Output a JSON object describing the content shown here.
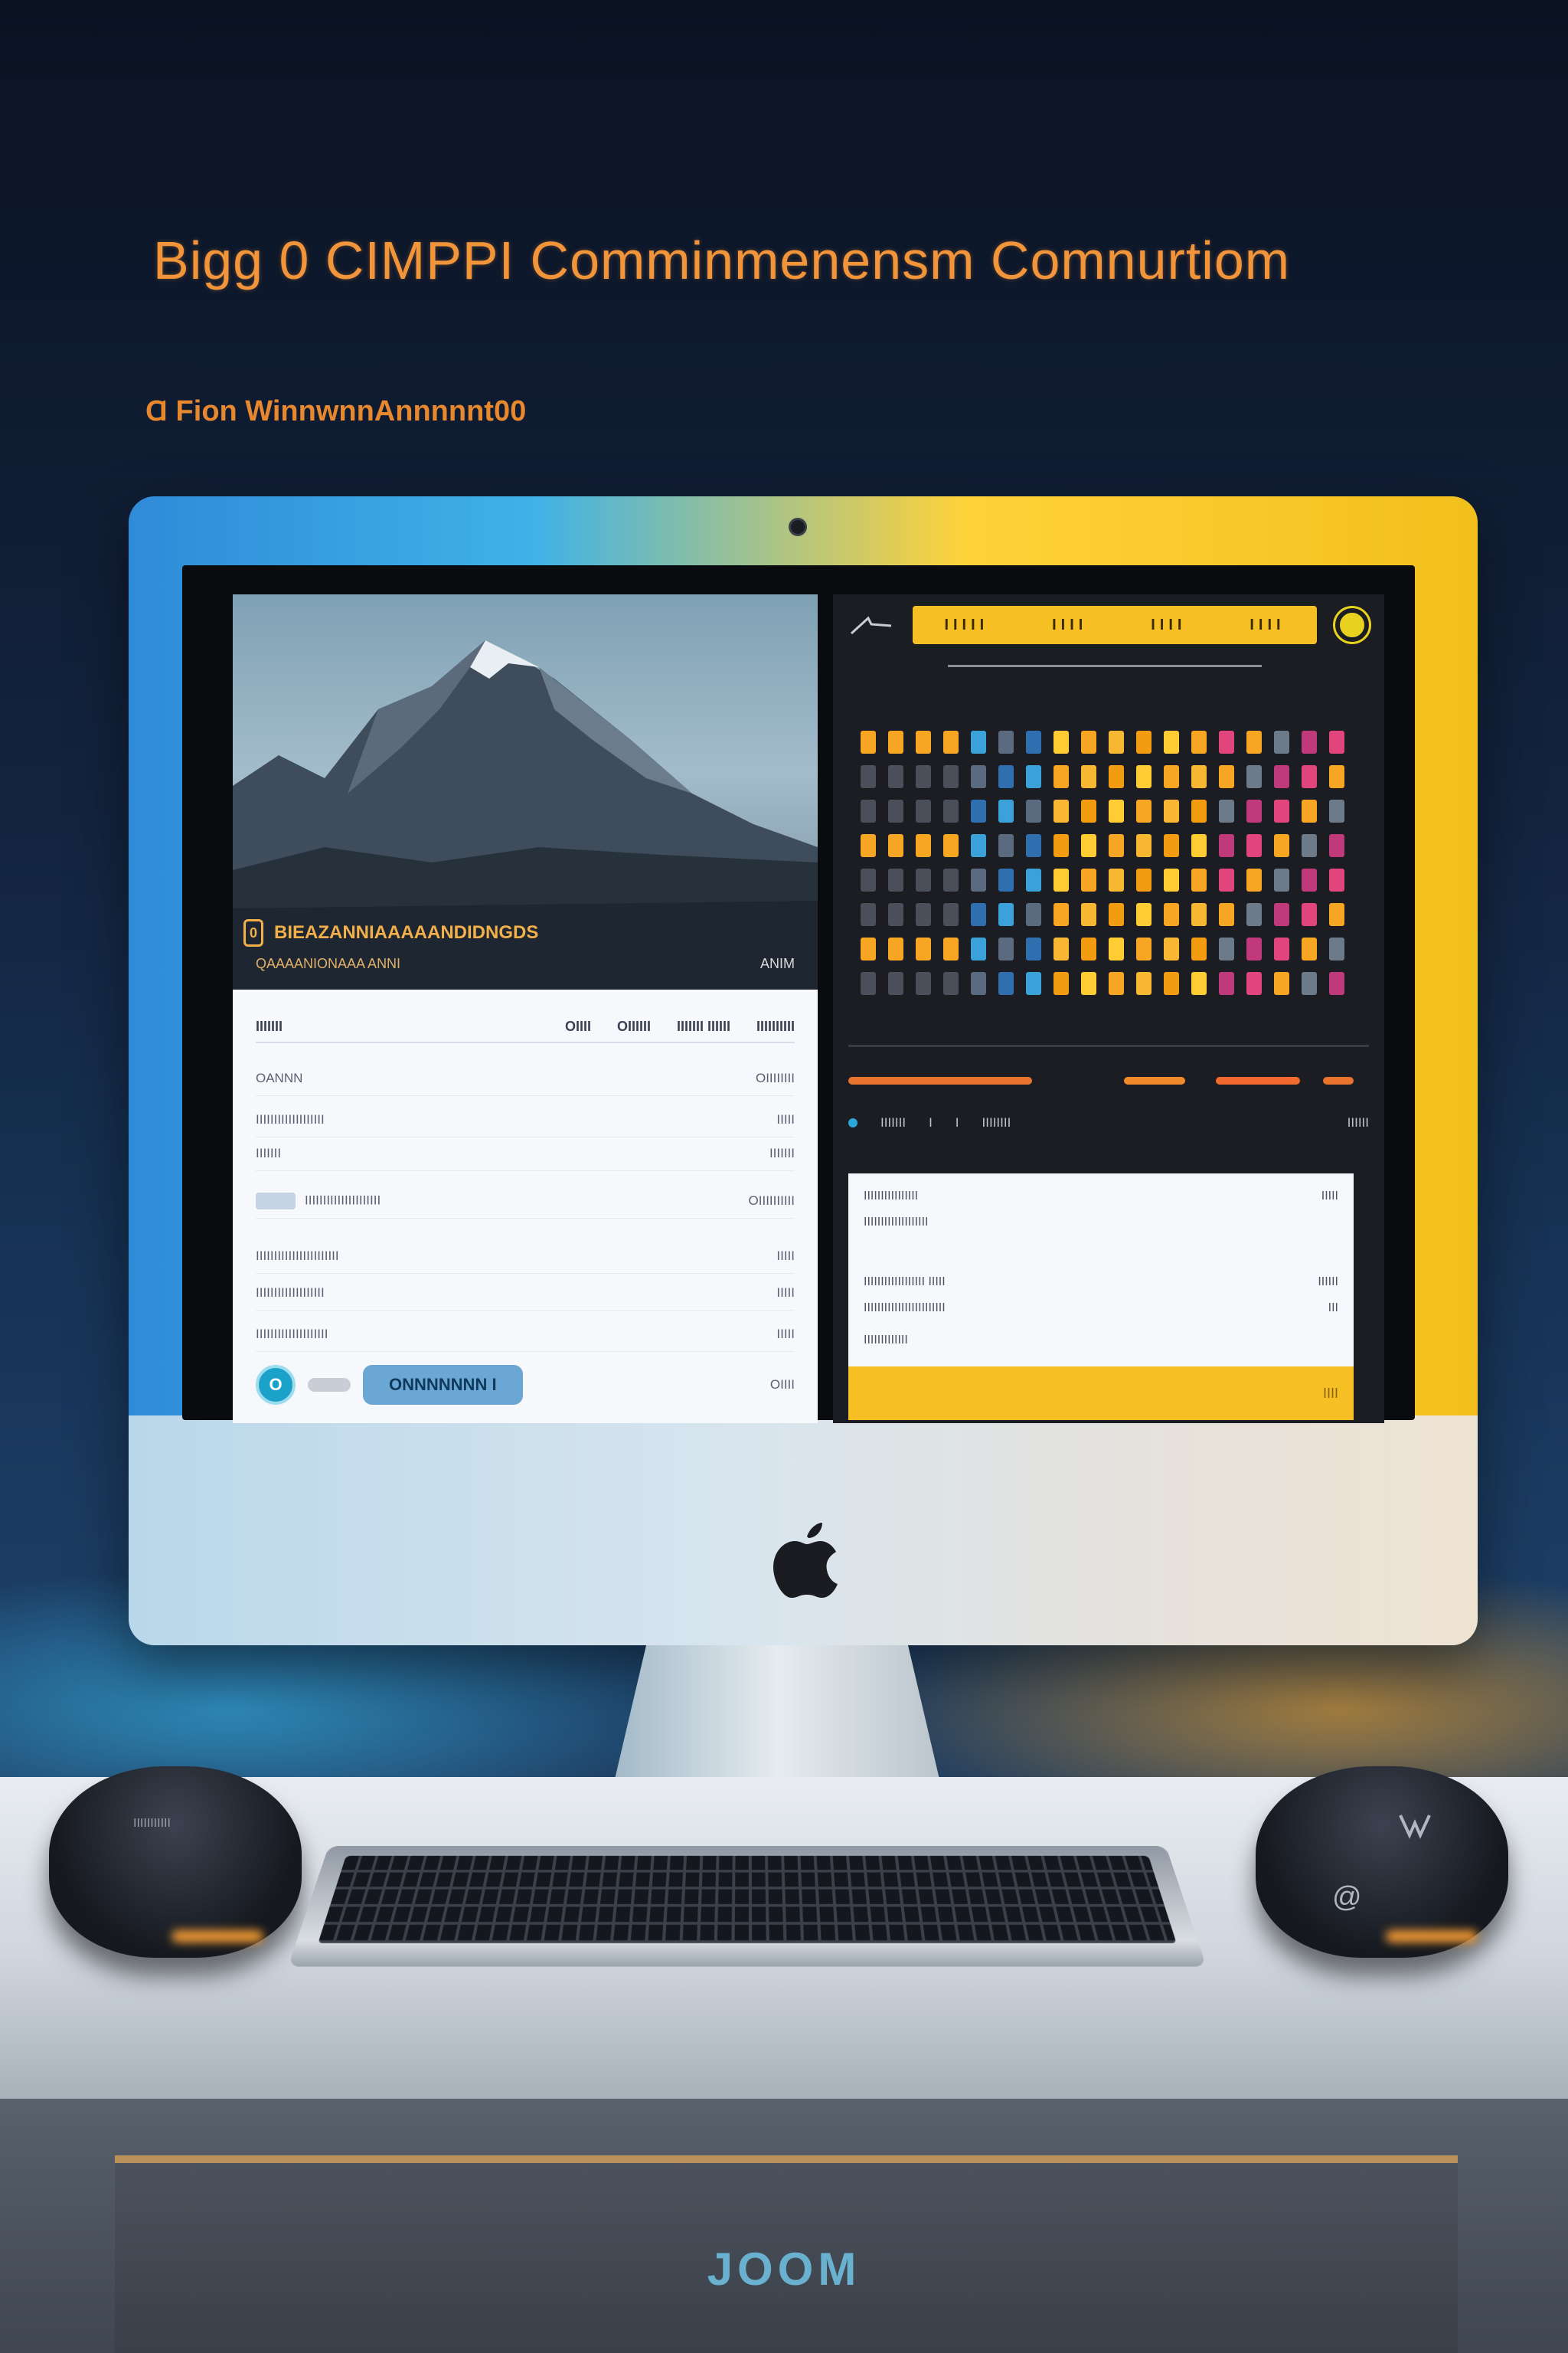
{
  "poster": {
    "headline": "Bigg 0 CIMPPI Comminmenensm Comnurtiom",
    "subline": "Ɑ Fion WinnwnnAnnnnnt00"
  },
  "screen": {
    "left_window": {
      "photo_caption_number": "0",
      "photo_caption": "BIEAZANNIAAAAANDIDNGDS",
      "photo_subcaption": "QAAAANIONAAA ANNI",
      "photo_subcaption_right": "ANIM",
      "table_header_label": "IIIIIII",
      "table_columns": [
        "OIIII",
        "OIIIIII",
        "IIIIIII IIIIII",
        "IIIIIIIIII"
      ],
      "rows": [
        {
          "label": "OANNN",
          "value": "OIIIIIIII"
        },
        {
          "label": "IIIIIIIIIIIIIIIIIII",
          "value": "IIIII"
        },
        {
          "label": "IIIIIII",
          "value": "IIIIIII"
        },
        {
          "label": "IIIIIIIIIIIIIIIIIIIII",
          "value": "OIIIIIIIIII"
        },
        {
          "label": "IIIIIIIIIIIIIIIIIIIIIII",
          "value": "IIIII"
        },
        {
          "label": "IIIIIIIIIIIIIIIIIII",
          "value": "IIIII"
        },
        {
          "label": "IIIIIIIIIIIIIIIIIIII",
          "value": "IIIII"
        }
      ],
      "primary_button": "ONNNNNNN I",
      "footer_right": "OIIII"
    },
    "right_window": {
      "yellow_bar_items": [
        "IIIII",
        "IIII",
        "IIII",
        "IIII"
      ],
      "nav_items": [
        "IIIIIII",
        "I",
        "I",
        "IIIIIIII",
        "IIIIII"
      ],
      "card_rows": [
        {
          "label": "IIIIIIIIIIIIIIII",
          "value": "IIIII"
        },
        {
          "label": "IIIIIIIIIIIIIIIIIII",
          "value": ""
        },
        {
          "label": "IIIIIIIIIIIIIIIIII IIIII",
          "value": "IIIIII"
        },
        {
          "label": "IIIIIIIIIIIIIIIIIIIIIIII",
          "value": "III"
        },
        {
          "label": "IIIIIIIIIIIII",
          "value": ""
        }
      ],
      "card_footer": "IIII"
    }
  },
  "peripherals": {
    "speaker_left_label": "IIIIIIIIIII",
    "speaker_right_mark": "@",
    "cabinet_brand": "JOOM"
  },
  "colors": {
    "accent_orange": "#f2953a",
    "accent_yellow": "#f6bf24",
    "screen_dark": "#1b1d23"
  }
}
